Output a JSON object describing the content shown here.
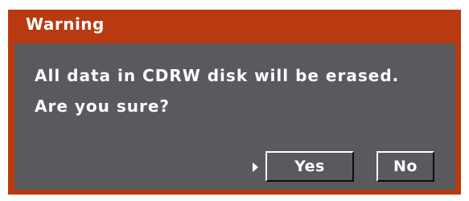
{
  "dialog": {
    "title": "Warning",
    "message_line1": "All data in CDRW disk will be erased.",
    "message_line2": "Are you sure?",
    "focus_indicator_icon": "right-triangle-icon",
    "buttons": {
      "yes_label": "Yes",
      "no_label": "No"
    },
    "colors": {
      "frame": "#b93a10",
      "panel": "#5a5a5e",
      "text": "#ffffff"
    }
  }
}
